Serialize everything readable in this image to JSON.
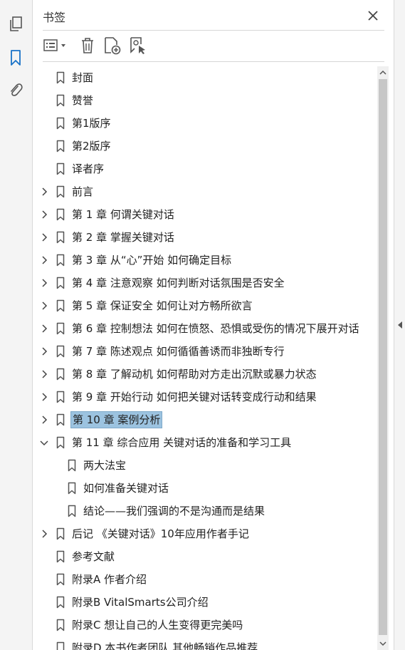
{
  "rail": {
    "items": [
      {
        "name": "pages",
        "icon": "pages-icon"
      },
      {
        "name": "bookmarks",
        "icon": "bookmark-icon",
        "active": true
      },
      {
        "name": "attachments",
        "icon": "paperclip-icon"
      }
    ]
  },
  "panel": {
    "title": "书签",
    "close_icon": "close-icon"
  },
  "toolbar": {
    "options_icon": "list-options-icon",
    "delete_icon": "trash-icon",
    "add_icon": "add-bookmark-icon",
    "properties_icon": "bookmark-settings-icon"
  },
  "bookmarks": [
    {
      "label": "封面",
      "level": 0,
      "expander": "none"
    },
    {
      "label": "赞誉",
      "level": 0,
      "expander": "none"
    },
    {
      "label": "第1版序",
      "level": 0,
      "expander": "none"
    },
    {
      "label": "第2版序",
      "level": 0,
      "expander": "none"
    },
    {
      "label": "译者序",
      "level": 0,
      "expander": "none"
    },
    {
      "label": "前言",
      "level": 0,
      "expander": "collapsed"
    },
    {
      "label": "第 1 章 何谓关键对话",
      "level": 0,
      "expander": "collapsed"
    },
    {
      "label": "第 2 章 掌握关键对话",
      "level": 0,
      "expander": "collapsed"
    },
    {
      "label": "第 3 章 从“心”开始 如何确定目标",
      "level": 0,
      "expander": "collapsed"
    },
    {
      "label": "第 4 章 注意观察 如何判断对话氛围是否安全",
      "level": 0,
      "expander": "collapsed"
    },
    {
      "label": "第 5 章 保证安全 如何让对方畅所欲言",
      "level": 0,
      "expander": "collapsed"
    },
    {
      "label": "第 6 章 控制想法 如何在愤怒、恐惧或受伤的情况下展开对话",
      "level": 0,
      "expander": "collapsed"
    },
    {
      "label": "第 7 章 陈述观点 如何循循善诱而非独断专行",
      "level": 0,
      "expander": "collapsed"
    },
    {
      "label": "第 8 章 了解动机 如何帮助对方走出沉默或暴力状态",
      "level": 0,
      "expander": "collapsed"
    },
    {
      "label": "第 9 章 开始行动 如何把关键对话转变成行动和结果",
      "level": 0,
      "expander": "collapsed"
    },
    {
      "label": "第 10 章 案例分析",
      "level": 0,
      "expander": "collapsed",
      "selected": true
    },
    {
      "label": "第 11 章 综合应用 关键对话的准备和学习工具",
      "level": 0,
      "expander": "expanded"
    },
    {
      "label": "两大法宝",
      "level": 1,
      "expander": "none"
    },
    {
      "label": "如何准备关键对话",
      "level": 1,
      "expander": "none"
    },
    {
      "label": "结论——我们强调的不是沟通而是结果",
      "level": 1,
      "expander": "none"
    },
    {
      "label": "后记 《关键对话》10年应用作者手记",
      "level": 0,
      "expander": "collapsed"
    },
    {
      "label": "参考文献",
      "level": 0,
      "expander": "none"
    },
    {
      "label": "附录A 作者介绍",
      "level": 0,
      "expander": "none"
    },
    {
      "label": "附录B VitalSmarts公司介绍",
      "level": 0,
      "expander": "none"
    },
    {
      "label": "附录C 想让自己的人生变得更完美吗",
      "level": 0,
      "expander": "none"
    },
    {
      "label": "附录D 本书作者团队 其他畅销作品推荐",
      "level": 0,
      "expander": "none"
    }
  ],
  "colors": {
    "accent": "#1a73c8",
    "selection": "#9cc3e0",
    "icon": "#555555"
  },
  "scrollbar": {
    "up_icon": "chevron-up-icon",
    "down_icon": "chevron-down-icon"
  }
}
